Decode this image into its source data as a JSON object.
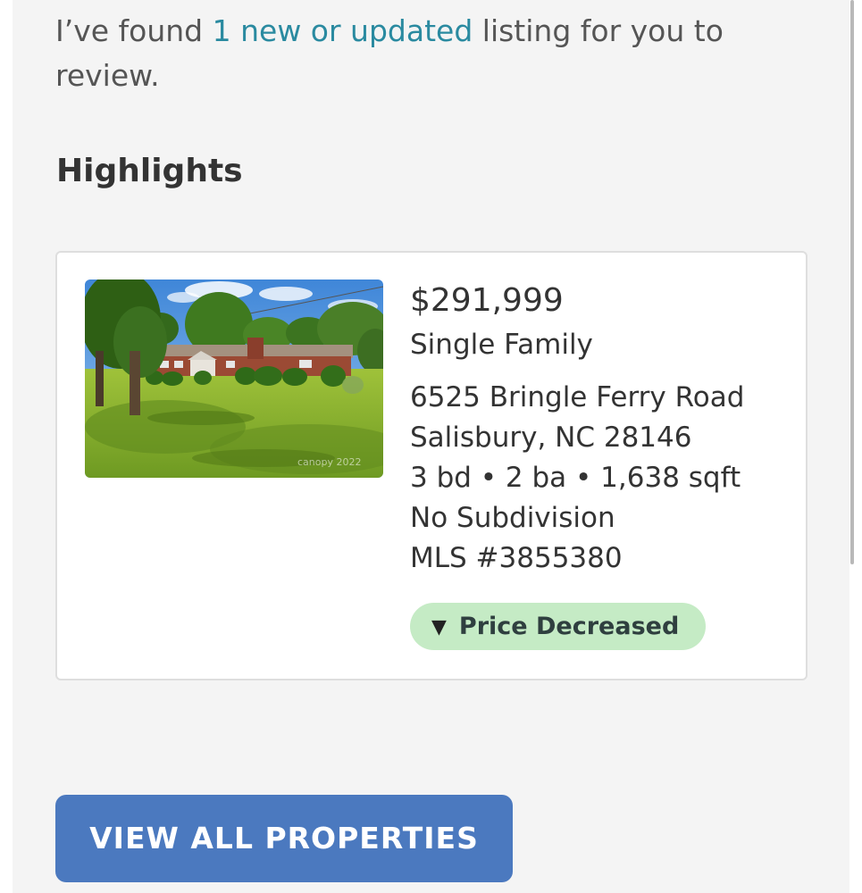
{
  "intro": {
    "prefix": "I’ve found ",
    "link": "1 new or updated",
    "suffix": " listing for you to review."
  },
  "highlights": {
    "heading": "Highlights"
  },
  "listing": {
    "price": "$291,999",
    "property_type": "Single Family",
    "street": "6525 Bringle Ferry Road",
    "city_state_zip": "Salisbury, NC 28146",
    "specs": "3 bd • 2 ba • 1,638 sqft",
    "subdivision": "No Subdivision",
    "mls": "MLS #3855380",
    "photo_watermark": "canopy 2022",
    "status_icon": "down-triangle-icon",
    "status": "Price Decreased"
  },
  "actions": {
    "view_all_label": "VIEW ALL PROPERTIES"
  },
  "colors": {
    "link": "#2a8aa0",
    "button": "#4b79bf",
    "badge": "#c5ebc5"
  }
}
